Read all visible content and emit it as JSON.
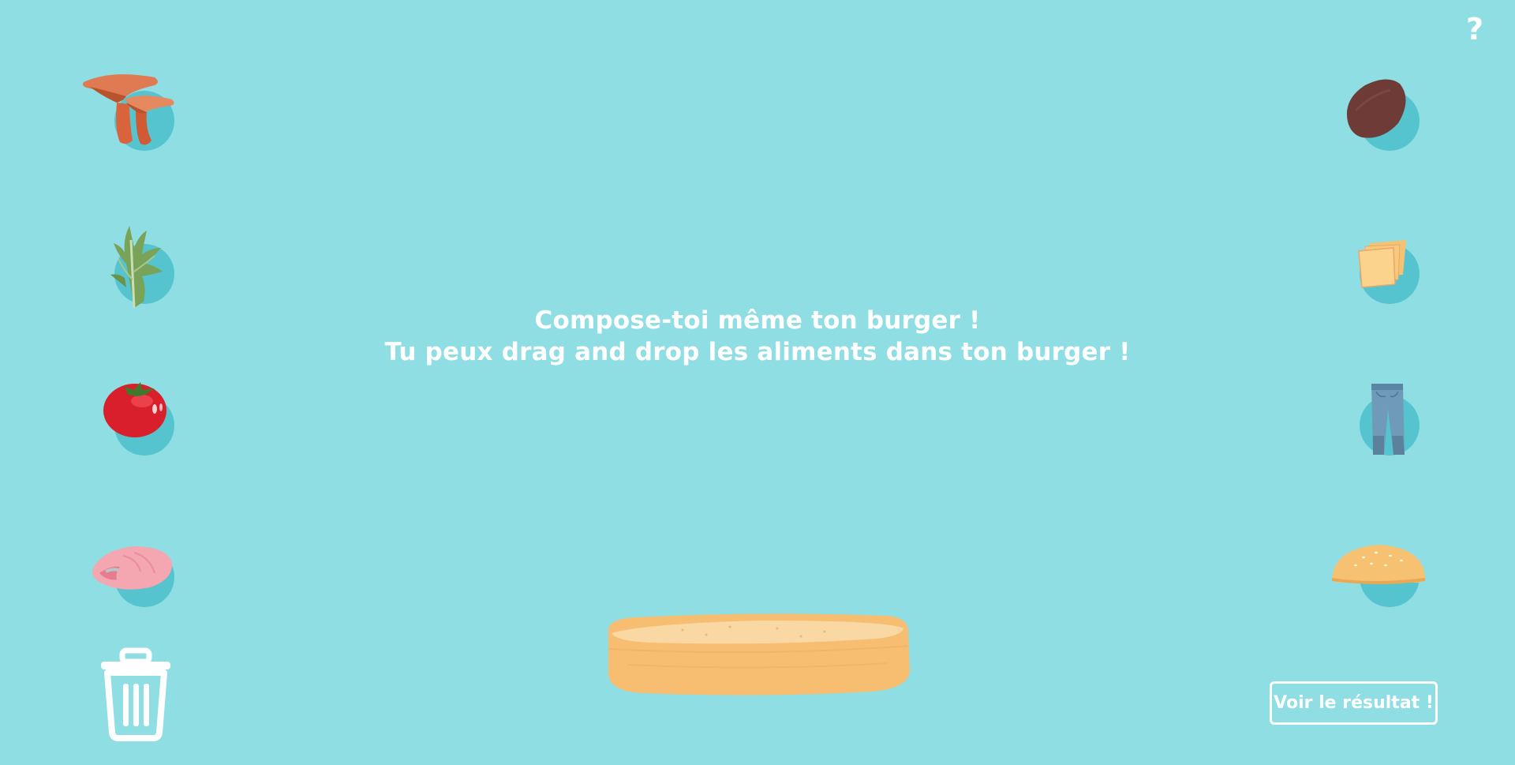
{
  "help": {
    "label": "?"
  },
  "instructions": {
    "line1": "Compose-toi même ton burger !",
    "line2": "Tu peux drag and drop les aliments dans ton burger !"
  },
  "ingredients_left": [
    {
      "name": "mushroom-icon"
    },
    {
      "name": "lettuce-icon"
    },
    {
      "name": "tomato-icon"
    },
    {
      "name": "salmon-icon"
    }
  ],
  "ingredients_right": [
    {
      "name": "patty-icon"
    },
    {
      "name": "cheese-icon"
    },
    {
      "name": "jeans-icon"
    },
    {
      "name": "top-bun-icon"
    }
  ],
  "trash": {
    "name": "trash-icon"
  },
  "bottom_bun": {
    "name": "bottom-bun"
  },
  "result_button": {
    "label": "Voir le résultat !"
  },
  "colors": {
    "background": "#8fdee4",
    "disc": "#56c4cf",
    "text": "#ffffff"
  }
}
